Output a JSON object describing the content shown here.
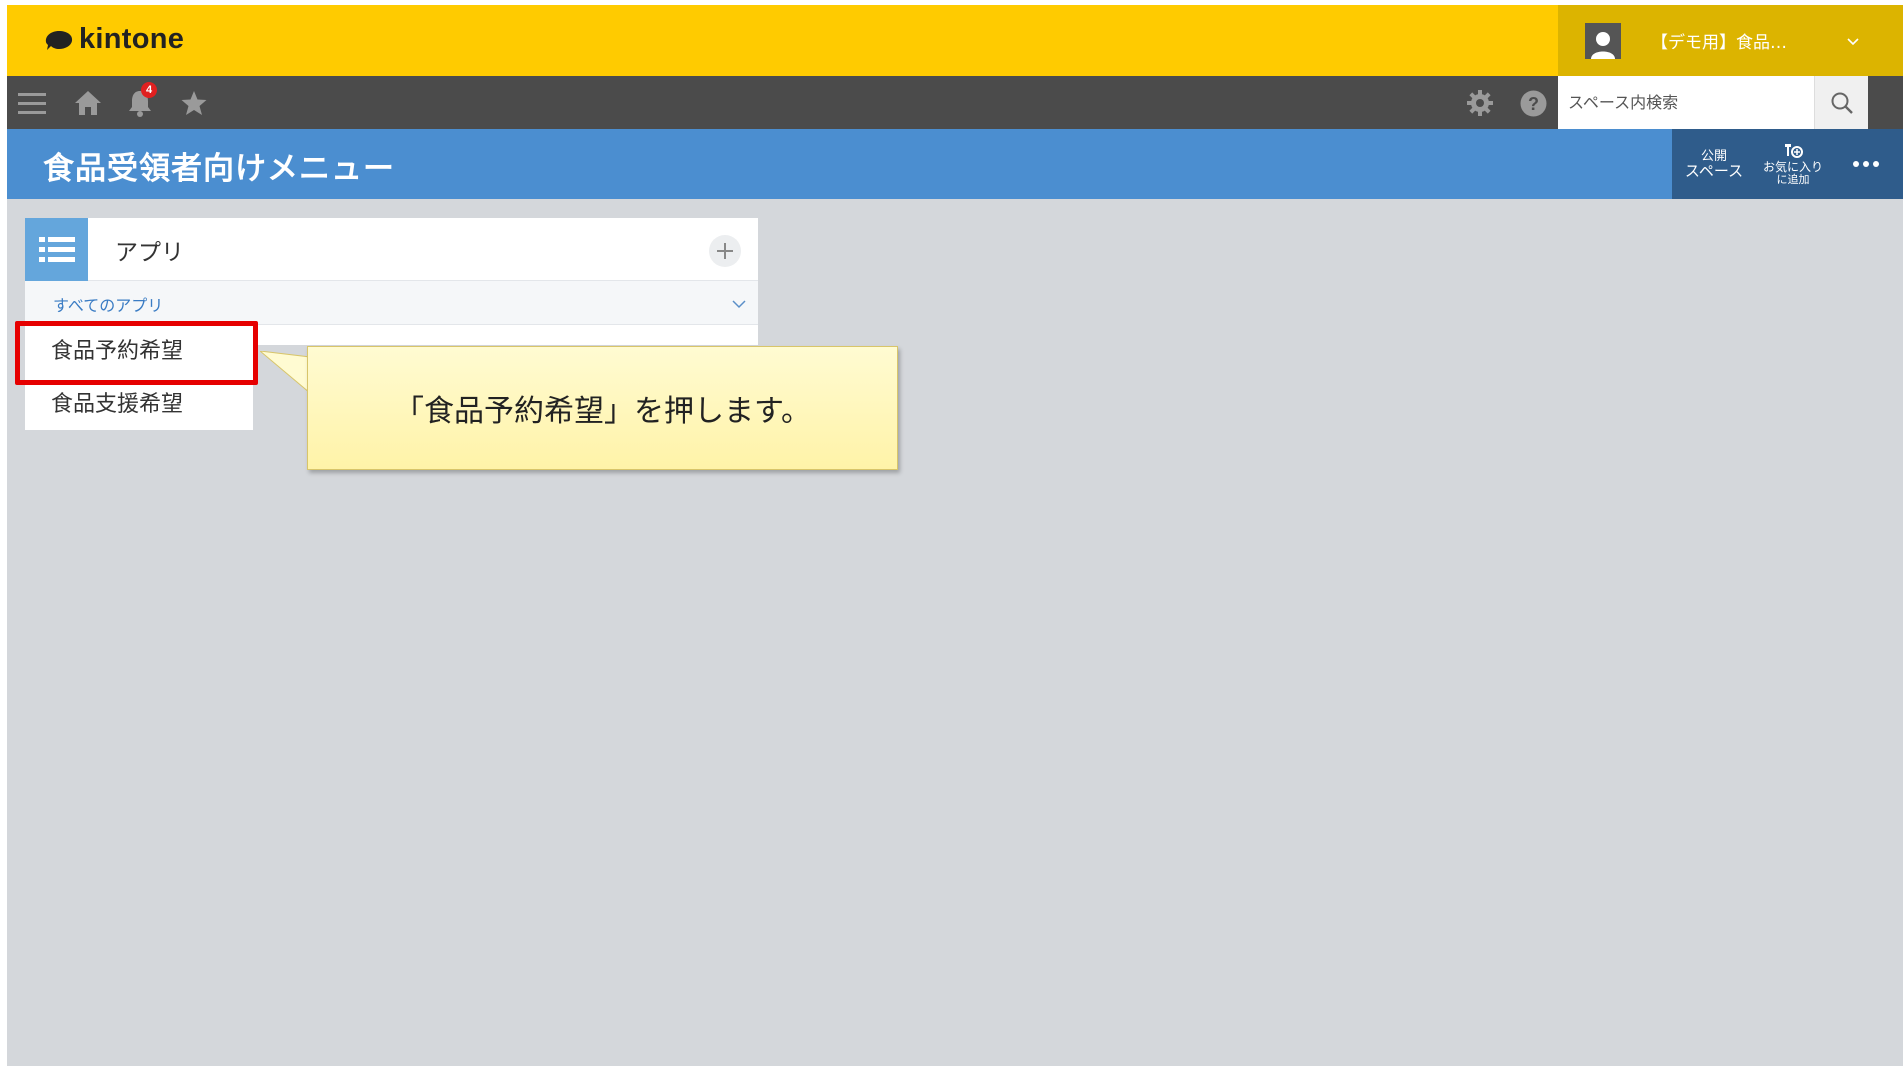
{
  "header": {
    "logo_text": "kintone",
    "user_name": "【デモ用】食品…",
    "brand_color": "#ffcb00"
  },
  "navbar": {
    "notification_count": "4",
    "search_placeholder": "スペース内検索",
    "icons": [
      "menu-icon",
      "home-icon",
      "bell-icon",
      "star-icon",
      "gear-icon",
      "help-icon",
      "search-icon"
    ]
  },
  "space": {
    "title": "食品受領者向けメニュー",
    "public_line1": "公開",
    "public_line2": "スペース",
    "fav_line1": "お気に入り",
    "fav_line2": "に追加",
    "color": "#4b8ed0"
  },
  "widget": {
    "title": "アプリ",
    "filter": "すべてのアプリ",
    "apps": [
      {
        "label": "食品予約希望"
      },
      {
        "label": "食品支援希望"
      }
    ]
  },
  "callout": {
    "text": "「食品予約希望」を押します。"
  }
}
